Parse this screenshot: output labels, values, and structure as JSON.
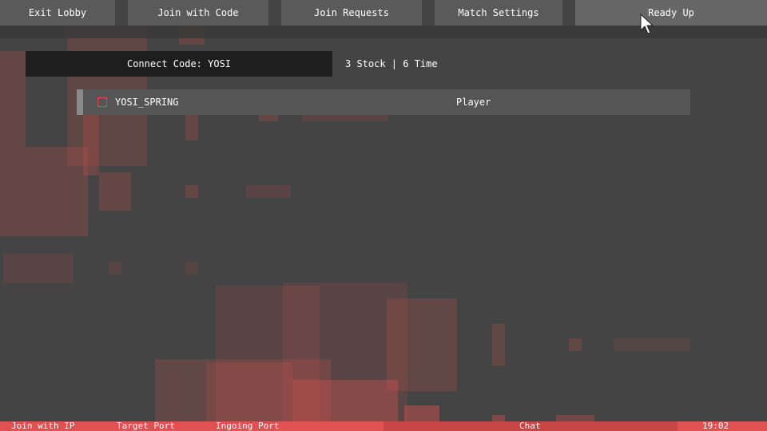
{
  "top_menu": {
    "exit_lobby": "Exit Lobby",
    "join_with_code": "Join with Code",
    "join_requests": "Join Requests",
    "match_settings": "Match Settings",
    "ready_up": "Ready Up"
  },
  "lobby": {
    "connect_code": "Connect Code: YOSI",
    "match_info": "3 Stock | 6 Time"
  },
  "players": [
    {
      "name": "YOSI_SPRING",
      "role": "Player",
      "ready": false
    }
  ],
  "bottom_bar": {
    "join_with_ip": "Join with IP",
    "target_port": "Target Port",
    "ingoing_port": "Ingoing Port",
    "chat": "Chat",
    "clock": "19:02"
  },
  "colors": {
    "accent_red": "#e05252",
    "panel_gray": "#5a5a5a",
    "background": "#444444"
  }
}
